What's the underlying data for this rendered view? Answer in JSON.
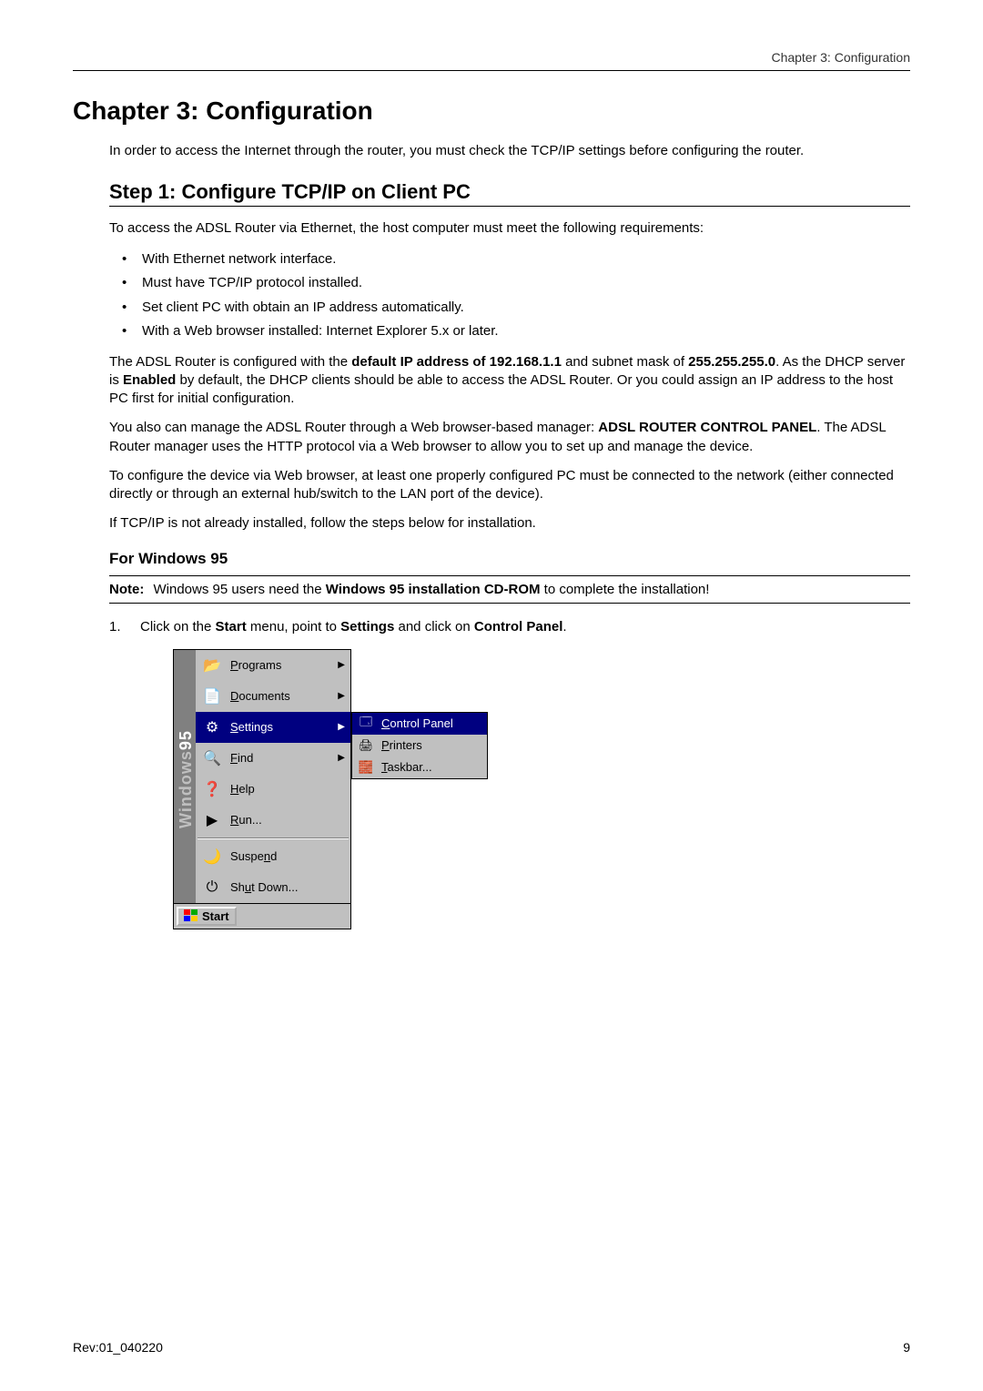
{
  "header": {
    "chapter_label": "Chapter 3: Configuration"
  },
  "h1": "Chapter 3: Configuration",
  "intro": "In order to access the Internet through the router, you must check the TCP/IP settings before configuring the router.",
  "h2": "Step 1: Configure TCP/IP on Client PC",
  "p_req": "To access the ADSL Router via Ethernet, the host computer must meet the following requirements:",
  "bullets": [
    "With Ethernet network interface.",
    "Must have TCP/IP protocol installed.",
    "Set client PC with obtain an IP address automatically.",
    "With a Web browser installed: Internet Explorer 5.x or later."
  ],
  "p_ip": {
    "pre1": "The ADSL Router is configured with the ",
    "b1": "default IP address of 192.168.1.1",
    "mid1": " and subnet mask of ",
    "b2": "255.255.255.0",
    "mid2": ". As the DHCP server is ",
    "b3": "Enabled",
    "post": " by default, the DHCP clients should be able to access the ADSL Router. Or you could assign an IP address to the host PC first for initial configuration."
  },
  "p_manage": {
    "pre": "You also can manage the ADSL Router through a Web browser-based manager: ",
    "b": "ADSL ROUTER CONTROL PANEL",
    "post": ". The ADSL Router manager uses the HTTP protocol via a Web browser to allow you to set up and manage the device."
  },
  "p_webcfg": "To configure the device via Web browser, at least one properly configured PC must be connected to the network (either connected directly or through an external hub/switch to the LAN port of the device).",
  "p_install": "If TCP/IP is not already installed, follow the steps below for installation.",
  "h3": "For Windows 95",
  "note": {
    "label": "Note:",
    "pre": "Windows 95 users need the ",
    "b": "Windows 95 installation CD-ROM",
    "post": " to complete the installation!"
  },
  "step1": {
    "num": "1.",
    "pre": "Click on the ",
    "b1": "Start",
    "mid1": " menu, point to ",
    "b2": "Settings",
    "mid2": " and click on ",
    "b3": "Control Panel",
    "post": "."
  },
  "start_menu": {
    "brand_prefix": "Windows",
    "brand_suffix": "95",
    "items": [
      {
        "key": "programs",
        "label": "Programs",
        "underline": "P",
        "rest": "rograms",
        "icon": "📂",
        "arrow": true
      },
      {
        "key": "documents",
        "label": "Documents",
        "underline": "D",
        "rest": "ocuments",
        "icon": "📄",
        "arrow": true
      },
      {
        "key": "settings",
        "label": "Settings",
        "underline": "S",
        "rest": "ettings",
        "icon": "⚙",
        "arrow": true,
        "selected": true
      },
      {
        "key": "find",
        "label": "Find",
        "underline": "F",
        "rest": "ind",
        "icon": "🔍",
        "arrow": true
      },
      {
        "key": "help",
        "label": "Help",
        "underline": "H",
        "rest": "elp",
        "icon": "❓",
        "arrow": false
      },
      {
        "key": "run",
        "label": "Run...",
        "underline": "R",
        "rest": "un...",
        "icon": "▶",
        "arrow": false
      },
      {
        "key": "suspend",
        "label": "Suspend",
        "underline": "n",
        "pre": "Suspe",
        "rest": "d",
        "icon": "🌙",
        "arrow": false
      },
      {
        "key": "shutdown",
        "label": "Shut Down...",
        "underline": "u",
        "pre": "Sh",
        "rest": "t Down...",
        "icon": "⏻",
        "arrow": false
      }
    ],
    "start_label": "Start",
    "submenu": [
      {
        "key": "control-panel",
        "underline": "C",
        "rest": "ontrol Panel",
        "icon": "🗔",
        "selected": true
      },
      {
        "key": "printers",
        "underline": "P",
        "rest": "rinters",
        "icon": "🖨"
      },
      {
        "key": "taskbar",
        "underline": "T",
        "rest": "askbar...",
        "icon": "🧱"
      }
    ]
  },
  "footer": {
    "left": "Rev:01_040220",
    "right": "9"
  }
}
